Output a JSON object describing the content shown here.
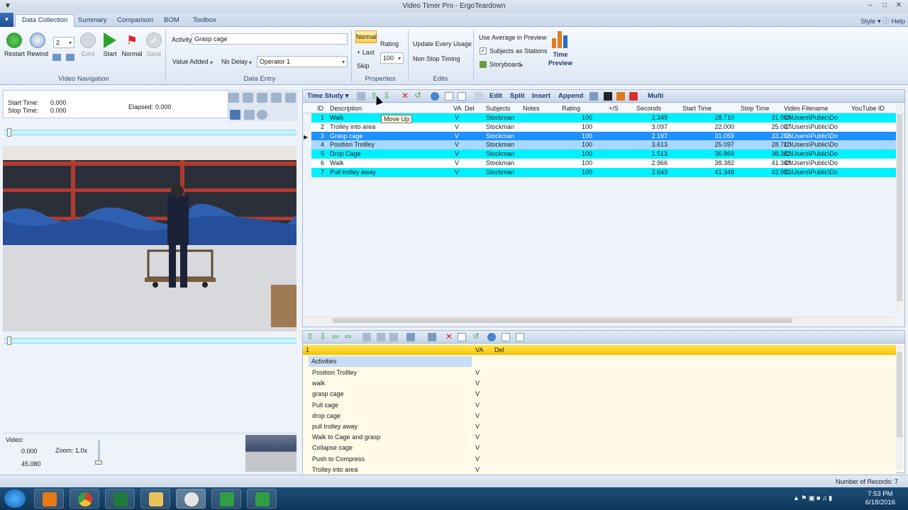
{
  "window": {
    "title": "Video Timer Pro - ErgoTeardown"
  },
  "ribbon_tabs": [
    "Data Collection",
    "Summary",
    "Comparison",
    "BOM",
    "Toolbox"
  ],
  "ribbon_right": {
    "style": "Style",
    "help": "Help"
  },
  "video_nav": {
    "label": "Video Navigation",
    "restart": "Restart",
    "rewind": "Rewind",
    "step_value": "2",
    "cont": "Cont",
    "start": "Start",
    "normal": "Normal",
    "save": "Save"
  },
  "data_entry": {
    "label": "Data Entry",
    "activity_label": "Activity",
    "activity_value": "Grasp cage",
    "value_added": "Value Added",
    "no_delay": "No Delay",
    "operator": "Operator 1"
  },
  "properties": {
    "label": "Properties",
    "normal": "Normal",
    "last": "+ Last",
    "skip": "Skip",
    "rating_label": "Rating",
    "rating_value": "100"
  },
  "edits": {
    "label": "Edits",
    "update_every_usage": "Update Every Usage",
    "non_stop_timing": "Non Stop Timing"
  },
  "preview": {
    "use_average": "Use Average in Preview",
    "subjects_as_stations": "Subjects as Stations",
    "storyboard": "Storyboard",
    "time_preview_1": "Time",
    "time_preview_2": "Preview"
  },
  "timing": {
    "start_label": "Start Time:",
    "start_value": "0.000",
    "stop_label": "Stop Time:",
    "stop_value": "0.000",
    "elapsed_label": "Elapsed:",
    "elapsed_value": "0.000"
  },
  "video_info": {
    "label": "Video:",
    "position": "0.000",
    "duration": "45.080",
    "zoom": "Zoom: 1.0x"
  },
  "grid_toolbar": {
    "time_study": "Time Study",
    "edit": "Edit",
    "split": "Split",
    "insert": "Insert",
    "append": "Append",
    "multi": "Multi"
  },
  "tooltip": "Move Up",
  "grid_columns": [
    "ID",
    "Description",
    "VA",
    "Del",
    "Subjects",
    "Notes",
    "Rating",
    "+/S",
    "Seconds",
    "Start Time",
    "Stop Time",
    "Video Filename",
    "YouTube ID"
  ],
  "grid_rows": [
    {
      "id": "1",
      "desc": "Walk",
      "va": "V",
      "subj": "Stockman",
      "rating": "100",
      "sec": "2.349",
      "start": "28.710",
      "stop": "31.059",
      "file": "C:\\Users\\Public\\Do",
      "style": "cyan"
    },
    {
      "id": "2",
      "desc": "Trolley into area",
      "va": "V",
      "subj": "Stockman",
      "rating": "100",
      "sec": "3.097",
      "start": "22.000",
      "stop": "25.097",
      "file": "C:\\Users\\Public\\Do",
      "style": "white"
    },
    {
      "id": "3",
      "desc": "Grasp cage",
      "va": "V",
      "subj": "Stockman",
      "rating": "100",
      "sec": "2.197",
      "start": "31.059",
      "stop": "33.256",
      "file": "C:\\Users\\Public\\Do",
      "style": "selected"
    },
    {
      "id": "4",
      "desc": "Position Trollley",
      "va": "V",
      "subj": "Stockman",
      "rating": "100",
      "sec": "3.613",
      "start": "25.097",
      "stop": "28.710",
      "file": "C:\\Users\\Public\\Do",
      "style": "light"
    },
    {
      "id": "5",
      "desc": "Drop Cage",
      "va": "V",
      "subj": "Stockman",
      "rating": "100",
      "sec": "1.513",
      "start": "36.869",
      "stop": "38.382",
      "file": "C:\\Users\\Public\\Do",
      "style": "cyan"
    },
    {
      "id": "6",
      "desc": "Walk",
      "va": "V",
      "subj": "Stockman",
      "rating": "100",
      "sec": "2.966",
      "start": "38.382",
      "stop": "41.348",
      "file": "C:\\Users\\Public\\Do",
      "style": "white"
    },
    {
      "id": "7",
      "desc": "Pull trolley away",
      "va": "V",
      "subj": "Stockman",
      "rating": "100",
      "sec": "2.643",
      "start": "41.348",
      "stop": "43.991",
      "file": "C:\\Users\\Public\\Do",
      "style": "cyan"
    }
  ],
  "library": {
    "header_marker": "1",
    "col_va": "VA",
    "col_del": "Del",
    "group": "Activities",
    "items": [
      {
        "name": "Position Trollley",
        "va": "V"
      },
      {
        "name": "walk",
        "va": "V"
      },
      {
        "name": "grasp cage",
        "va": "V"
      },
      {
        "name": "Pull cage",
        "va": "V"
      },
      {
        "name": "drop cage",
        "va": "V"
      },
      {
        "name": "pull trolley away",
        "va": "V"
      },
      {
        "name": "Walk to Cage and grasp",
        "va": "V"
      },
      {
        "name": "Collapse cage",
        "va": "V"
      },
      {
        "name": "Push to Compress",
        "va": "V"
      },
      {
        "name": "Trolley into area",
        "va": "V"
      }
    ]
  },
  "status": {
    "records": "Number of Records: 7"
  },
  "taskbar": {
    "time": "7:53 PM",
    "date": "6/18/2016"
  },
  "colors": {
    "cyan": "#00f0ff",
    "selected": "#1e90ff",
    "light": "#a8d8ff"
  }
}
